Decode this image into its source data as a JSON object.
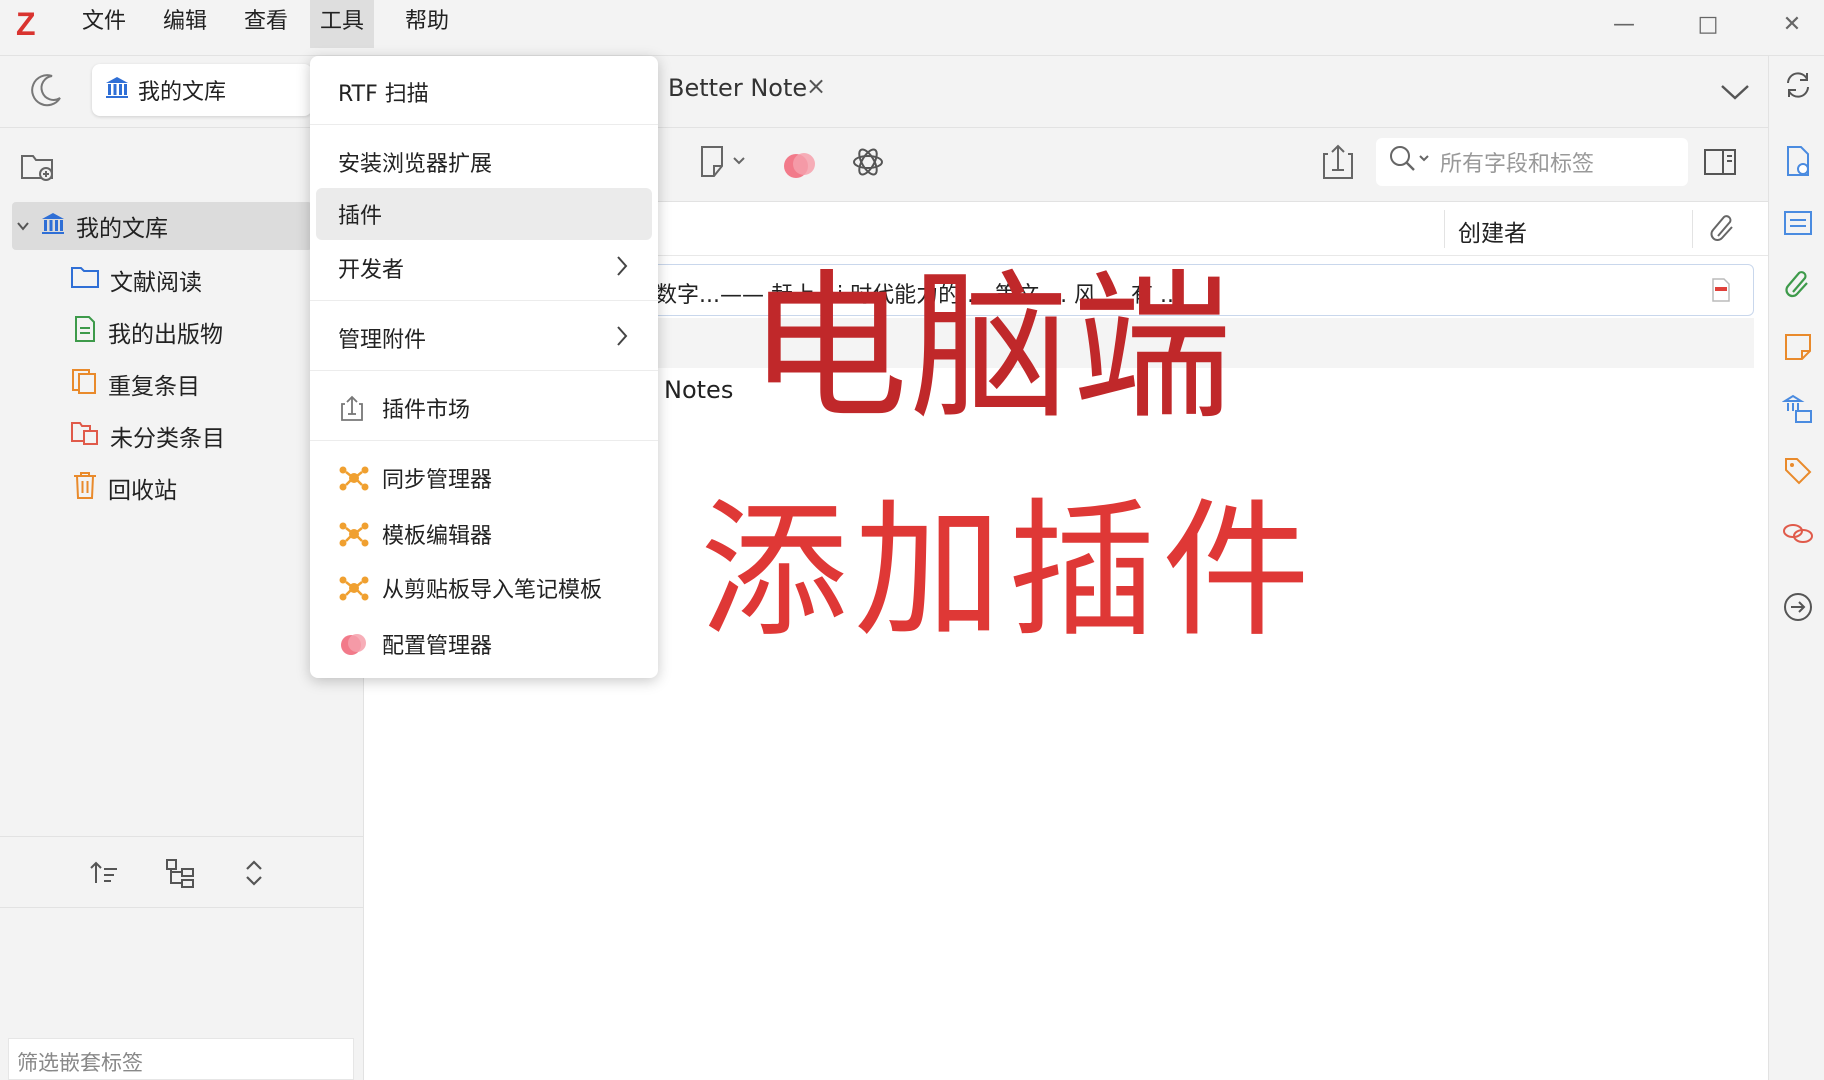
{
  "app": {
    "logo": "Z"
  },
  "menubar": {
    "items": [
      "文件",
      "编辑",
      "查看",
      "工具",
      "帮助"
    ],
    "active": "工具"
  },
  "window_controls": {
    "minimize": "—",
    "maximize": "□",
    "close": "✕"
  },
  "tabs": {
    "library": "我的文库",
    "note": "Better Note",
    "close": "×"
  },
  "left_pane": {
    "root": "我的文库",
    "items": [
      "文献阅读",
      "我的出版物",
      "重复条目",
      "未分类条目",
      "回收站"
    ],
    "tag_filter_placeholder": "筛选嵌套标签"
  },
  "toolbar": {
    "search_placeholder": "所有字段和标签"
  },
  "table": {
    "columns": {
      "creator": "创建者"
    },
    "row1_title_fragment": "数字...—— 赶上 Ai 时代能力的 ... 策文 ... 风 ... 有 ...",
    "row3_label": "Notes"
  },
  "dropdown_menu": {
    "items": [
      {
        "label": "RTF 扫描",
        "icon": "",
        "submenu": false
      },
      {
        "label": "安装浏览器扩展",
        "icon": "",
        "submenu": false
      },
      {
        "label": "插件",
        "icon": "",
        "submenu": false,
        "highlighted": true
      },
      {
        "label": "开发者",
        "icon": "",
        "submenu": true
      },
      {
        "label": "管理附件",
        "icon": "",
        "submenu": true
      },
      {
        "label": "插件市场",
        "icon": "plugin-market-icon",
        "submenu": false
      },
      {
        "label": "同步管理器",
        "icon": "plugin-star-icon",
        "submenu": false
      },
      {
        "label": "模板编辑器",
        "icon": "plugin-star-icon",
        "submenu": false
      },
      {
        "label": "从剪贴板导入笔记模板",
        "icon": "plugin-star-icon",
        "submenu": false
      },
      {
        "label": "配置管理器",
        "icon": "pink-flower-icon",
        "submenu": false
      }
    ],
    "chevron": ">"
  },
  "overlay": {
    "line1": "电脑端",
    "line2": "添加插件"
  },
  "colors": {
    "brand": "#d9332f",
    "overlay_dark": "#c0282a",
    "overlay_light": "#df3836",
    "icon_blue": "#2f6fd6",
    "icon_orange": "#e98a2b",
    "icon_green": "#3d9a4a"
  }
}
